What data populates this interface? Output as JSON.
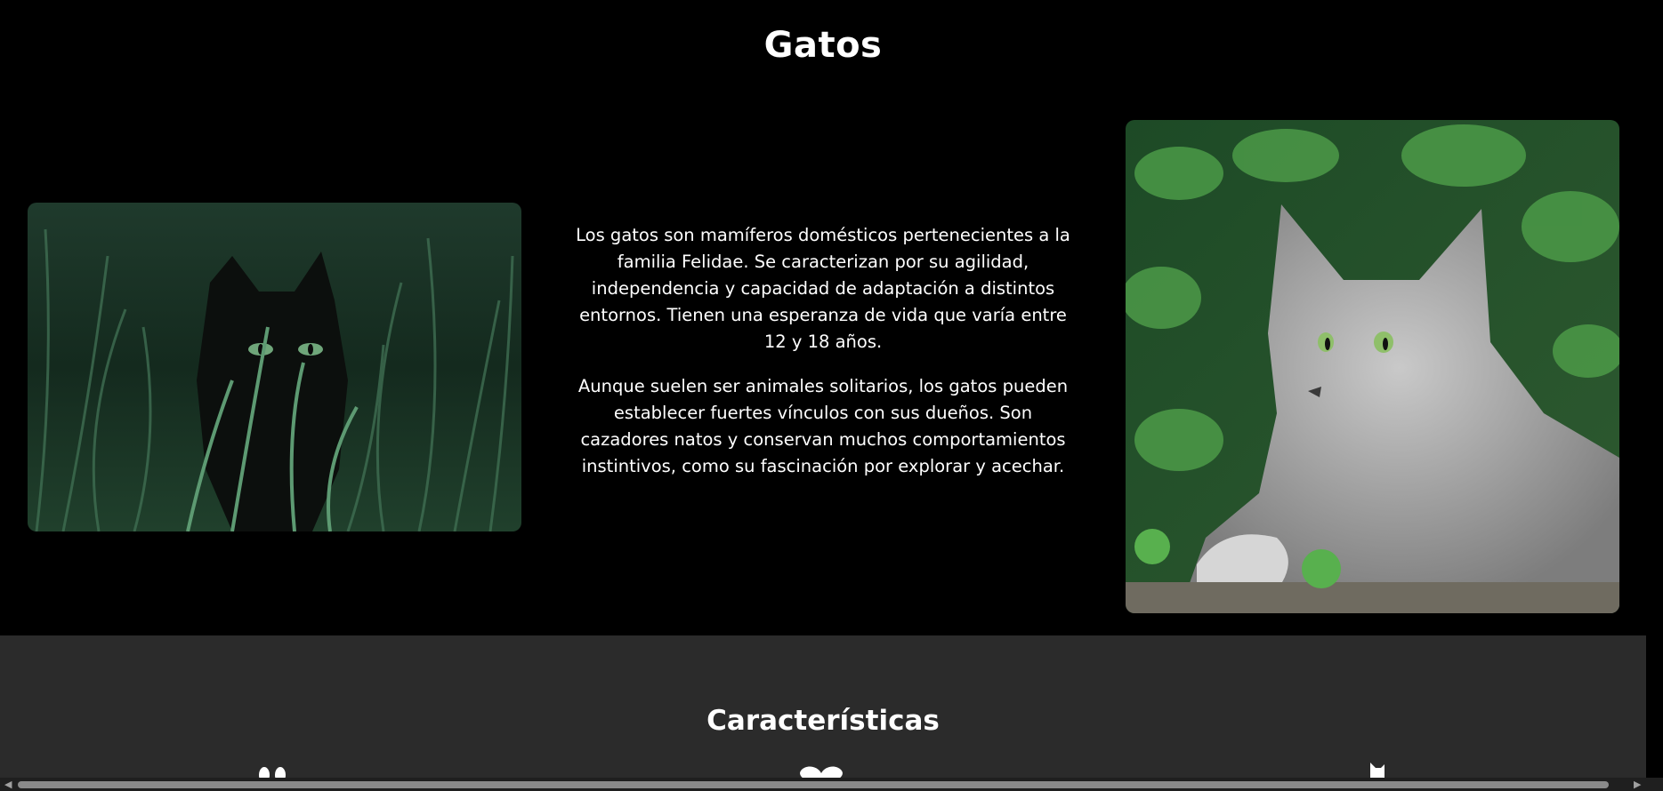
{
  "hero": {
    "title": "Gatos",
    "paragraphs": [
      "Los gatos son mamíferos domésticos pertenecientes a la familia Felidae. Se caracterizan por su agilidad, independencia y capacidad de adaptación a distintos entornos. Tienen una esperanza de vida que varía entre 12 y 18 años.",
      "Aunque suelen ser animales solitarios, los gatos pueden establecer fuertes vínculos con sus dueños. Son cazadores natos y conservan muchos comportamientos instintivos, como su fascinación por explorar y acechar."
    ],
    "images": {
      "left": "black-cat-in-grass",
      "right": "gray-longhair-cat-in-foliage"
    }
  },
  "features": {
    "title": "Características",
    "icons": [
      "paw-icon",
      "heart-icon",
      "cat-icon"
    ]
  },
  "colors": {
    "hero_background": "#000000",
    "features_background": "#2b2b2b",
    "text": "#ffffff"
  }
}
